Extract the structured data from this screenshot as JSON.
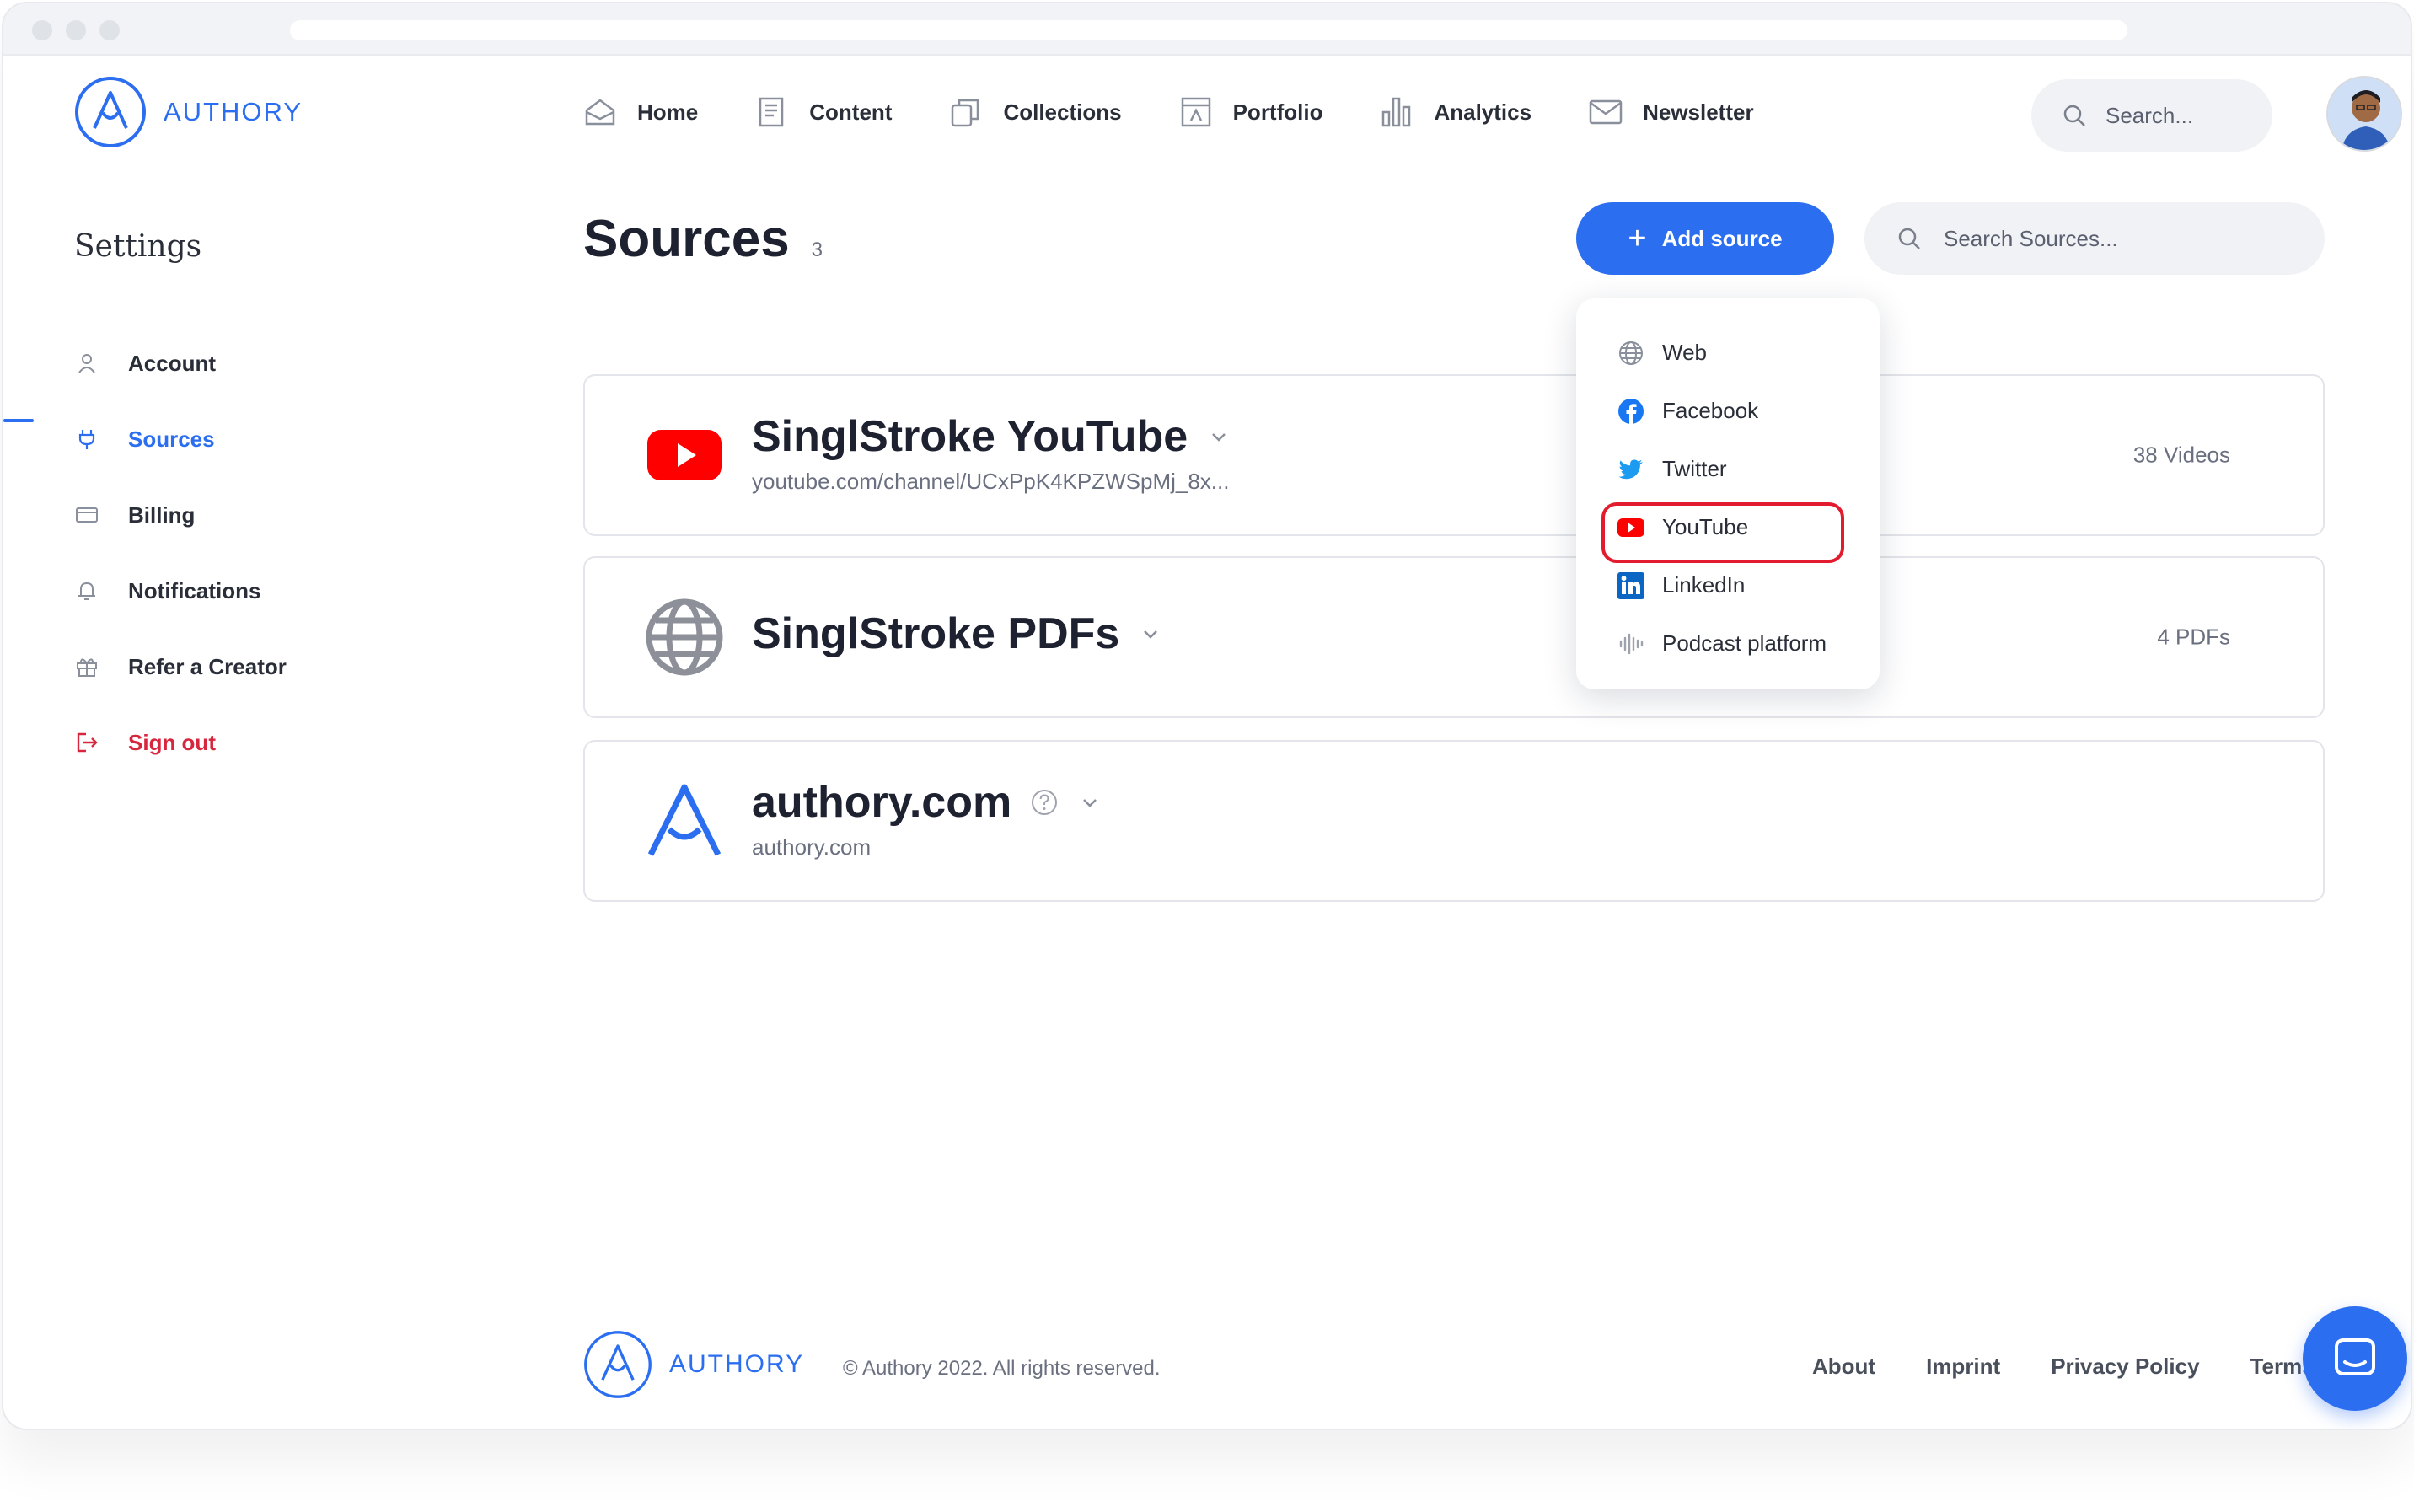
{
  "brand": {
    "name": "AUTHORY"
  },
  "nav": {
    "items": [
      {
        "label": "Home",
        "icon": "home-icon"
      },
      {
        "label": "Content",
        "icon": "content-icon"
      },
      {
        "label": "Collections",
        "icon": "collections-icon"
      },
      {
        "label": "Portfolio",
        "icon": "portfolio-icon"
      },
      {
        "label": "Analytics",
        "icon": "analytics-icon"
      },
      {
        "label": "Newsletter",
        "icon": "newsletter-icon"
      }
    ],
    "search_placeholder": "Search..."
  },
  "sidebar": {
    "title": "Settings",
    "items": [
      {
        "label": "Account",
        "icon": "user-icon"
      },
      {
        "label": "Sources",
        "icon": "plug-icon",
        "active": true
      },
      {
        "label": "Billing",
        "icon": "credit-card-icon"
      },
      {
        "label": "Notifications",
        "icon": "bell-icon"
      },
      {
        "label": "Refer a Creator",
        "icon": "gift-icon"
      },
      {
        "label": "Sign out",
        "icon": "sign-out-icon"
      }
    ]
  },
  "main": {
    "title": "Sources",
    "count": "3",
    "add_button": "Add source",
    "search_placeholder": "Search Sources..."
  },
  "sources": [
    {
      "name": "SinglStroke YouTube",
      "url": "youtube.com/channel/UCxPpK4KPZWSpMj_8x...",
      "stat": "38 Videos",
      "icon": "youtube-icon"
    },
    {
      "name": "SinglStroke PDFs",
      "url": "",
      "stat": "4 PDFs",
      "icon": "globe-icon"
    },
    {
      "name": "authory.com",
      "url": "authory.com",
      "stat": "",
      "icon": "authory-logo-icon"
    }
  ],
  "dropdown": {
    "items": [
      {
        "label": "Web",
        "icon": "globe-icon"
      },
      {
        "label": "Facebook",
        "icon": "facebook-icon"
      },
      {
        "label": "Twitter",
        "icon": "twitter-icon"
      },
      {
        "label": "YouTube",
        "icon": "youtube-icon",
        "highlighted": true
      },
      {
        "label": "LinkedIn",
        "icon": "linkedin-icon"
      },
      {
        "label": "Podcast platform",
        "icon": "podcast-icon"
      }
    ]
  },
  "footer": {
    "brand": "AUTHORY",
    "copyright": "© Authory 2022. All rights reserved.",
    "links": [
      "About",
      "Imprint",
      "Privacy Policy",
      "Terms"
    ]
  },
  "colors": {
    "accent": "#2c6ef0",
    "danger": "#d7263d",
    "youtube": "#ff0000",
    "highlight_ring": "#e21b2f"
  }
}
